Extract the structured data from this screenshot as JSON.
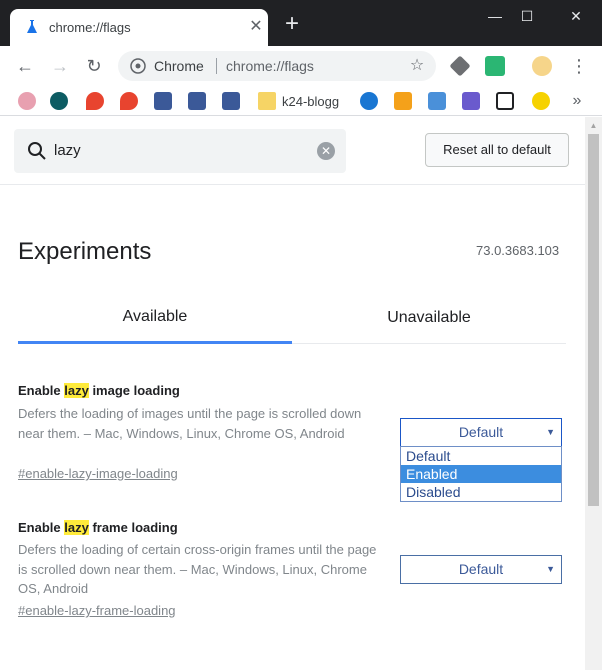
{
  "tab": {
    "title": "chrome://flags",
    "close": "✕",
    "new_tab": "+"
  },
  "window": {
    "minimize": "—",
    "maximize": "☐",
    "close": "✕"
  },
  "toolbar": {
    "back": "←",
    "forward": "→",
    "reload": "↻",
    "omnibox_label": "Chrome",
    "omnibox_url": "chrome://flags",
    "star": "☆",
    "menu": "⋮"
  },
  "bookmarks": {
    "label": "k24-blogg",
    "more": "»"
  },
  "search": {
    "value": "lazy",
    "clear": "✕"
  },
  "reset_button": "Reset all to default",
  "page": {
    "title": "Experiments",
    "version": "73.0.3683.103",
    "tabs": {
      "available": "Available",
      "unavailable": "Unavailable"
    }
  },
  "flags": [
    {
      "title_pre": "Enable ",
      "title_hl": "lazy",
      "title_post": " image loading",
      "desc": "Defers the loading of images until the page is scrolled down near them. – Mac, Windows, Linux, Chrome OS, Android",
      "link": "#enable-lazy-image-loading",
      "select_value": "Default",
      "options": [
        "Default",
        "Enabled",
        "Disabled"
      ],
      "highlighted_option": "Enabled"
    },
    {
      "title_pre": "Enable ",
      "title_hl": "lazy",
      "title_post": " frame loading",
      "desc": "Defers the loading of certain cross-origin frames until the page is scrolled down near them. – Mac, Windows, Linux, Chrome OS, Android",
      "link": "#enable-lazy-frame-loading",
      "select_value": "Default"
    }
  ],
  "select_arrow": "▼",
  "colors": {
    "accent": "#4285f4",
    "highlight": "#ffeb3b",
    "dropdown_selected": "#3c8ddf"
  }
}
